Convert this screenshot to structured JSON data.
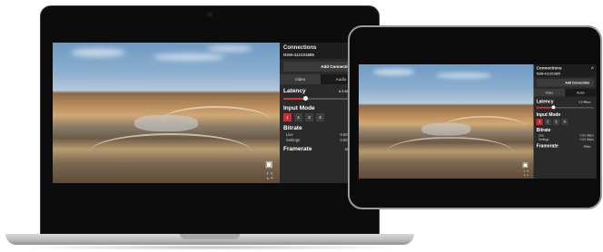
{
  "panel": {
    "title": "Connections",
    "device_id": "NSM-412101885",
    "add_connection_label": "Add Connection",
    "tabs": [
      {
        "label": "Video"
      },
      {
        "label": "Audio"
      }
    ],
    "latency": {
      "label": "Latency",
      "value_text": "0.5 Mbps",
      "level": 0.3
    },
    "input_mode": {
      "label": "Input Mode",
      "options": [
        "1",
        "2",
        "3",
        "4"
      ],
      "selected": "1"
    },
    "bitrate": {
      "label": "Bitrate",
      "rows": [
        {
          "label": "Live",
          "value": "0.00 Mbps"
        },
        {
          "label": "Settings",
          "value": "0.00 Mbps"
        }
      ]
    },
    "framerate": {
      "label": "Framerate",
      "value": "30fps"
    }
  },
  "video": {
    "scene": "aerial-quarry-landscape"
  },
  "icons": [
    "camera-icon",
    "fullscreen-icon",
    "collapse-chevron-icon"
  ],
  "colors": {
    "accent": "#d42b2b",
    "panel_bg": "#2a2a2a",
    "device_frame": "#0c0c0c"
  }
}
